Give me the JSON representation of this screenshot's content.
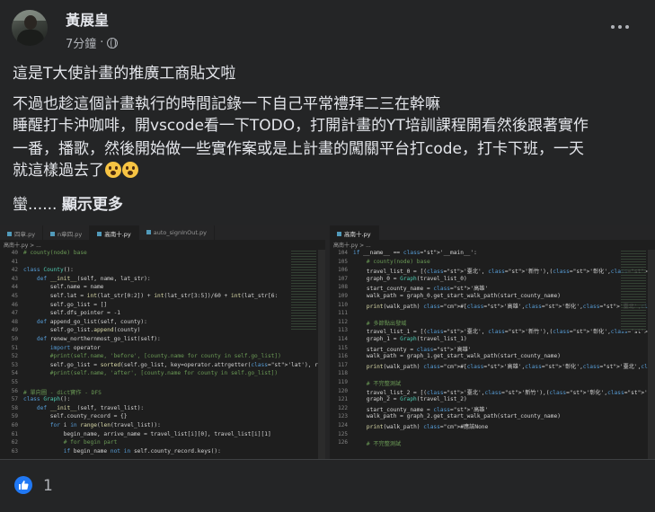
{
  "post": {
    "author": "黃展皇",
    "time": "7分鐘",
    "separator": "·",
    "paragraphs": [
      "這是T大使計畫的推廣工商貼文啦",
      "不過也趁這個計畫執行的時間記錄一下自己平常禮拜二三在幹嘛",
      "睡醒打卡沖咖啡，開vscode看一下TODO，打開計畫的YT培訓課程開看然後跟著實作",
      "一番，播歌，然後開始做一些實作案或是上計畫的闖關平台打code，打卡下班，一天",
      "就這樣過去了"
    ],
    "truncated": "蠻......",
    "show_more": "顯示更多",
    "emojis": [
      "astonished-face-emoji",
      "astonished-face-emoji"
    ]
  },
  "screenshot": {
    "left": {
      "tabs": [
        "四章.py",
        "n章四.py",
        "高南十.py",
        "auto_signInOut.py"
      ],
      "active_tab": 2,
      "breadcrumb": "高南十.py > ...",
      "lines": [
        {
          "n": "40",
          "code": "# county(node) base"
        },
        {
          "n": "41",
          "code": ""
        },
        {
          "n": "42",
          "code": "class County():"
        },
        {
          "n": "43",
          "code": "    def __init__(self, name, lat_str):"
        },
        {
          "n": "44",
          "code": "        self.name = name"
        },
        {
          "n": "45",
          "code": "        self.lat = int(lat_str[0:2]) + int(lat_str[3:5])/60 + int(lat_str[6:"
        },
        {
          "n": "46",
          "code": "        self.go_list = []"
        },
        {
          "n": "47",
          "code": "        self.dfs_pointer = -1"
        },
        {
          "n": "48",
          "code": "    def append_go_list(self, county):"
        },
        {
          "n": "49",
          "code": "        self.go_list.append(county)"
        },
        {
          "n": "50",
          "code": "    def renew_northernmost_go_list(self):"
        },
        {
          "n": "51",
          "code": "        import operator"
        },
        {
          "n": "52",
          "code": "        #print(self.name, 'before', [county.name for county in self.go_list])"
        },
        {
          "n": "53",
          "code": "        self.go_list = sorted(self.go_list, key=operator.attrgetter('lat'), r"
        },
        {
          "n": "54",
          "code": "        #print(self.name, 'after', [county.name for county in self.go_list])"
        },
        {
          "n": "55",
          "code": ""
        },
        {
          "n": "56",
          "code": "# 單向圖 - dict實作 - DFS"
        },
        {
          "n": "57",
          "code": "class Graph():"
        },
        {
          "n": "58",
          "code": "    def __init__(self, travel_list):"
        },
        {
          "n": "59",
          "code": "        self.county_record = {}"
        },
        {
          "n": "60",
          "code": "        for i in range(len(travel_list)):"
        },
        {
          "n": "61",
          "code": "            begin_name, arrive_name = travel_list[i][0], travel_list[i][1]"
        },
        {
          "n": "62",
          "code": "            # for begin part"
        },
        {
          "n": "63",
          "code": "            if begin_name not in self.county_record.keys():"
        }
      ]
    },
    "right": {
      "tabs": [
        "高南十.py"
      ],
      "active_tab": 0,
      "breadcrumb": "高南十.py > ...",
      "lines": [
        {
          "n": "104",
          "code": "if __name__ == '__main__':"
        },
        {
          "n": "105",
          "code": "    # county(node) base"
        },
        {
          "n": "106",
          "code": "    travel_list_0 = [('臺北', '新竹'),('彰化','臺北'),('高雄','彰化'),('新竹','"
        },
        {
          "n": "107",
          "code": "    graph_0 = Graph(travel_list_0)"
        },
        {
          "n": "108",
          "code": "    start_county_name = '高雄'"
        },
        {
          "n": "109",
          "code": "    walk_path = graph_0.get_start_walk_path(start_county_name)"
        },
        {
          "n": "110",
          "code": "    print(walk_path) #['高雄','彰化','臺北','新竹','高雄']"
        },
        {
          "n": "111",
          "code": ""
        },
        {
          "n": "112",
          "code": "    # 多節點出發域"
        },
        {
          "n": "113",
          "code": "    travel_list_1 = [('臺北', '新竹'),('彰化','臺北'),('高雄','彰化'),('新竹','"
        },
        {
          "n": "114",
          "code": "    graph_1 = Graph(travel_list_1)"
        },
        {
          "n": "115",
          "code": "    start_county = '高雄'"
        },
        {
          "n": "116",
          "code": "    walk_path = graph_1.get_start_walk_path(start_county_name)"
        },
        {
          "n": "117",
          "code": "    print(walk_path) #['高雄','彰化','臺北','新竹','高雄']"
        },
        {
          "n": "118",
          "code": ""
        },
        {
          "n": "119",
          "code": "    # 不完整測試"
        },
        {
          "n": "120",
          "code": "    travel_list_2 = [('臺北','新竹'),('彰化','臺北'),('新竹','臺南'),('高雄','"
        },
        {
          "n": "121",
          "code": "    graph_2 = Graph(travel_list_2)"
        },
        {
          "n": "122",
          "code": "    start_county_name = '高雄'"
        },
        {
          "n": "123",
          "code": "    walk_path = graph_2.get_start_walk_path(start_county_name)"
        },
        {
          "n": "124",
          "code": "    print(walk_path) #應該None"
        },
        {
          "n": "125",
          "code": ""
        },
        {
          "n": "126",
          "code": "    # 不完整測試"
        }
      ]
    }
  },
  "reactions": {
    "icon": "thumbs-up-icon",
    "count": "1",
    "color": "#2078f4"
  }
}
